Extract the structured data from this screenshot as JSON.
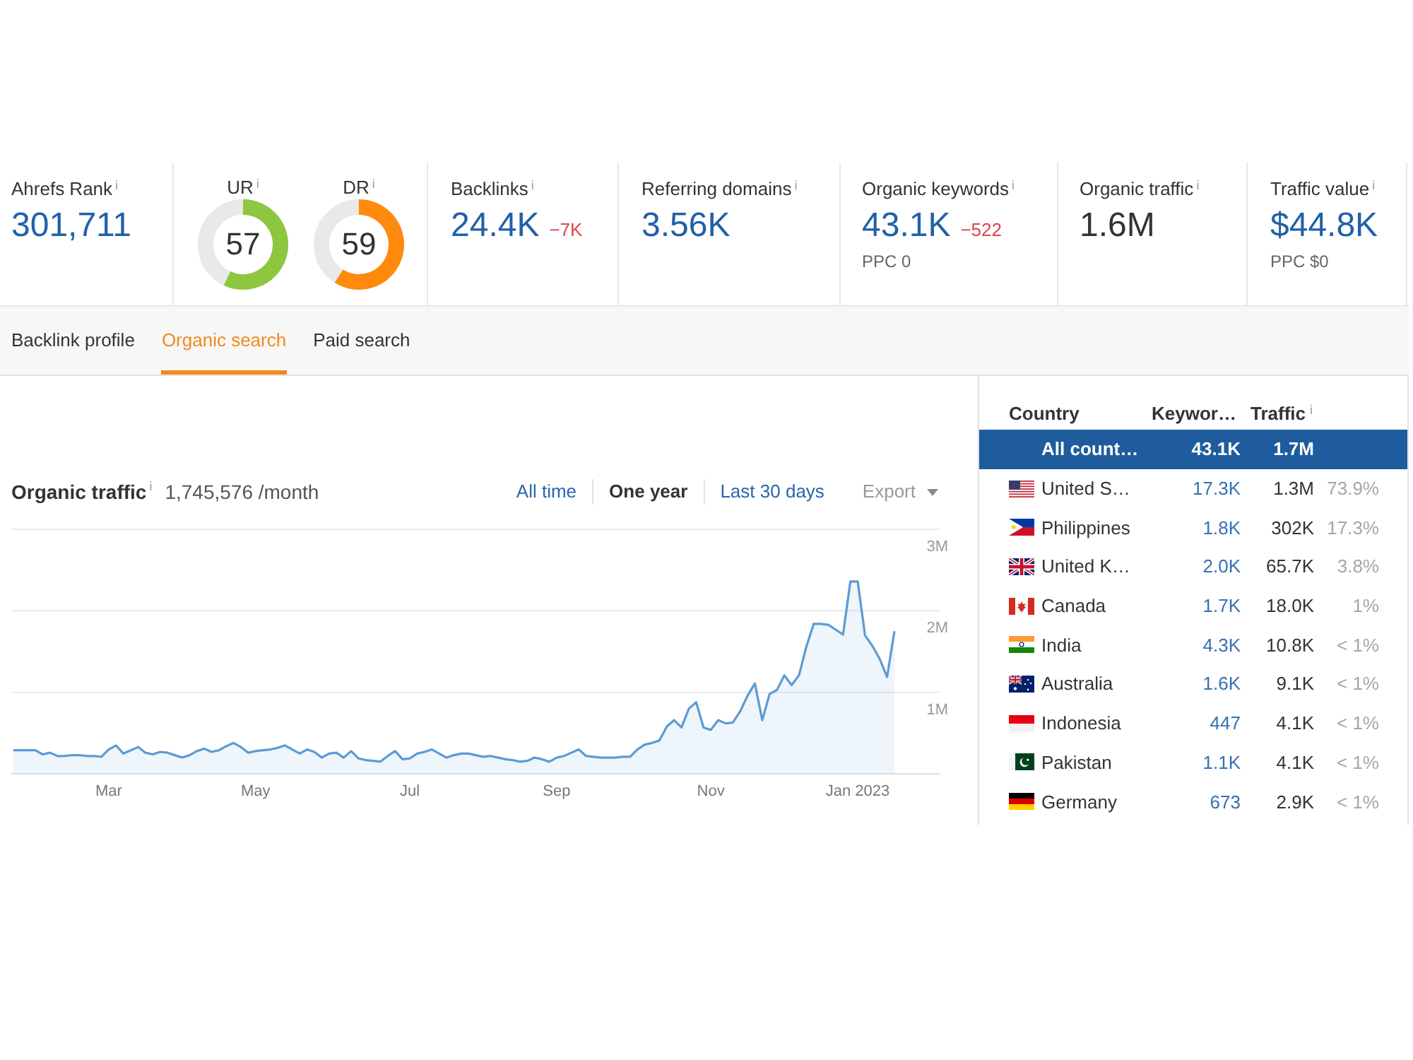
{
  "metrics": [
    {
      "kind": "stat",
      "label": "Ahrefs Rank",
      "info": "i",
      "value": "301,711",
      "linked": true
    },
    {
      "kind": "gauges",
      "gauges": [
        {
          "label": "UR",
          "info": "i",
          "value": "57",
          "level": 0.57,
          "color": "#8dc63f"
        },
        {
          "label": "DR",
          "info": "i",
          "value": "59",
          "level": 0.59,
          "color": "#ff8a0d"
        }
      ]
    },
    {
      "kind": "stat",
      "label": "Backlinks",
      "info": "i",
      "value": "24.4K",
      "linked": true,
      "change": "−7K"
    },
    {
      "kind": "stat",
      "label": "Referring domains",
      "info": "i",
      "value": "3.56K",
      "linked": true
    },
    {
      "kind": "stat",
      "label": "Organic keywords",
      "info": "i",
      "value": "43.1K",
      "linked": true,
      "change": "−522",
      "sub": "PPC 0"
    },
    {
      "kind": "stat",
      "label": "Organic traffic",
      "info": "i",
      "value": "1.6M",
      "linked": false
    },
    {
      "kind": "stat",
      "label": "Traffic value",
      "info": "i",
      "value": "$44.8K",
      "linked": true,
      "sub": "PPC $0"
    }
  ],
  "tabs": [
    {
      "label": "Backlink profile",
      "selected": false
    },
    {
      "label": "Organic search",
      "selected": true
    },
    {
      "label": "Paid search",
      "selected": false
    }
  ],
  "traffic_chart": {
    "info": "i",
    "total": "1,745,576 /month",
    "ranges": [
      {
        "label": "All time",
        "selected": false
      },
      {
        "label": "One year",
        "selected": true
      },
      {
        "label": "Last 30 days",
        "selected": false
      }
    ],
    "export": "Export",
    "chart_data": {
      "type": "area",
      "title": "Organic traffic",
      "categories": [
        null,
        null,
        null,
        null,
        null,
        null,
        null,
        null,
        null,
        null,
        null,
        null,
        null,
        "Mar",
        null,
        null,
        null,
        null,
        null,
        null,
        null,
        null,
        null,
        null,
        null,
        null,
        null,
        null,
        null,
        null,
        null,
        null,
        null,
        "May",
        null,
        null,
        null,
        null,
        null,
        null,
        null,
        null,
        null,
        null,
        null,
        null,
        null,
        null,
        null,
        null,
        null,
        null,
        null,
        null,
        "Jul",
        null,
        null,
        null,
        null,
        null,
        null,
        null,
        null,
        null,
        null,
        null,
        null,
        null,
        null,
        null,
        null,
        null,
        null,
        null,
        "Sep",
        null,
        null,
        null,
        null,
        null,
        null,
        null,
        null,
        null,
        null,
        null,
        null,
        null,
        null,
        null,
        null,
        null,
        null,
        null,
        null,
        "Nov",
        null,
        null,
        null,
        null,
        null,
        null,
        null,
        null,
        null,
        null,
        null,
        null,
        null,
        null,
        null,
        null,
        null,
        null,
        null,
        "Jan 2023",
        null,
        null,
        null,
        null,
        null
      ],
      "series": [
        {
          "color": "#5b9bd5",
          "values": [
            280000,
            280000,
            280000,
            280000,
            230000,
            250000,
            210000,
            210000,
            220000,
            220000,
            210000,
            210000,
            200000,
            290000,
            340000,
            240000,
            280000,
            320000,
            250000,
            230000,
            260000,
            250000,
            220000,
            190000,
            220000,
            270000,
            300000,
            260000,
            280000,
            330000,
            370000,
            320000,
            250000,
            270000,
            280000,
            290000,
            310000,
            340000,
            290000,
            240000,
            290000,
            260000,
            190000,
            240000,
            250000,
            190000,
            270000,
            180000,
            160000,
            150000,
            140000,
            210000,
            270000,
            170000,
            180000,
            240000,
            260000,
            290000,
            240000,
            190000,
            220000,
            240000,
            240000,
            220000,
            200000,
            210000,
            190000,
            170000,
            160000,
            140000,
            150000,
            190000,
            170000,
            140000,
            190000,
            210000,
            250000,
            290000,
            210000,
            200000,
            190000,
            190000,
            190000,
            200000,
            200000,
            290000,
            350000,
            370000,
            400000,
            570000,
            650000,
            560000,
            790000,
            870000,
            560000,
            530000,
            650000,
            610000,
            620000,
            760000,
            950000,
            1100000,
            650000,
            970000,
            1020000,
            1200000,
            1080000,
            1200000,
            1550000,
            1830000,
            1830000,
            1820000,
            1760000,
            1700000,
            2350000,
            2350000,
            1690000,
            1560000,
            1400000,
            1180000,
            1740000
          ]
        }
      ],
      "ylim": [
        0,
        3000000
      ],
      "yticks": [
        {
          "value": 1000000,
          "label": "1M"
        },
        {
          "value": 2000000,
          "label": "2M"
        },
        {
          "value": 3000000,
          "label": "3M"
        }
      ]
    }
  },
  "countries": {
    "columns": [
      {
        "label": "Country"
      },
      {
        "label": "Keywor…"
      },
      {
        "label": "Traffic",
        "info": "i"
      }
    ],
    "rows": [
      {
        "kind": "all",
        "country": "All count…",
        "keywords": "43.1K",
        "traffic": "1.7M",
        "selected": true
      },
      {
        "kind": "us",
        "country": "United S…",
        "keywords": "17.3K",
        "traffic": "1.3M",
        "share": "73.9%",
        "selected": false
      },
      {
        "kind": "ph",
        "country": "Philippines",
        "keywords": "1.8K",
        "traffic": "302K",
        "share": "17.3%",
        "selected": false
      },
      {
        "kind": "gb",
        "country": "United K…",
        "keywords": "2.0K",
        "traffic": "65.7K",
        "share": "3.8%",
        "selected": false
      },
      {
        "kind": "ca",
        "country": "Canada",
        "keywords": "1.7K",
        "traffic": "18.0K",
        "share": "1%",
        "selected": false
      },
      {
        "kind": "in",
        "country": "India",
        "keywords": "4.3K",
        "traffic": "10.8K",
        "share": "< 1%",
        "selected": false
      },
      {
        "kind": "au",
        "country": "Australia",
        "keywords": "1.6K",
        "traffic": "9.1K",
        "share": "< 1%",
        "selected": false
      },
      {
        "kind": "id",
        "country": "Indonesia",
        "keywords": "447",
        "traffic": "4.1K",
        "share": "< 1%",
        "selected": false
      },
      {
        "kind": "pk",
        "country": "Pakistan",
        "keywords": "1.1K",
        "traffic": "4.1K",
        "share": "< 1%",
        "selected": false
      },
      {
        "kind": "de",
        "country": "Germany",
        "keywords": "673",
        "traffic": "2.9K",
        "share": "< 1%",
        "selected": false
      }
    ]
  }
}
